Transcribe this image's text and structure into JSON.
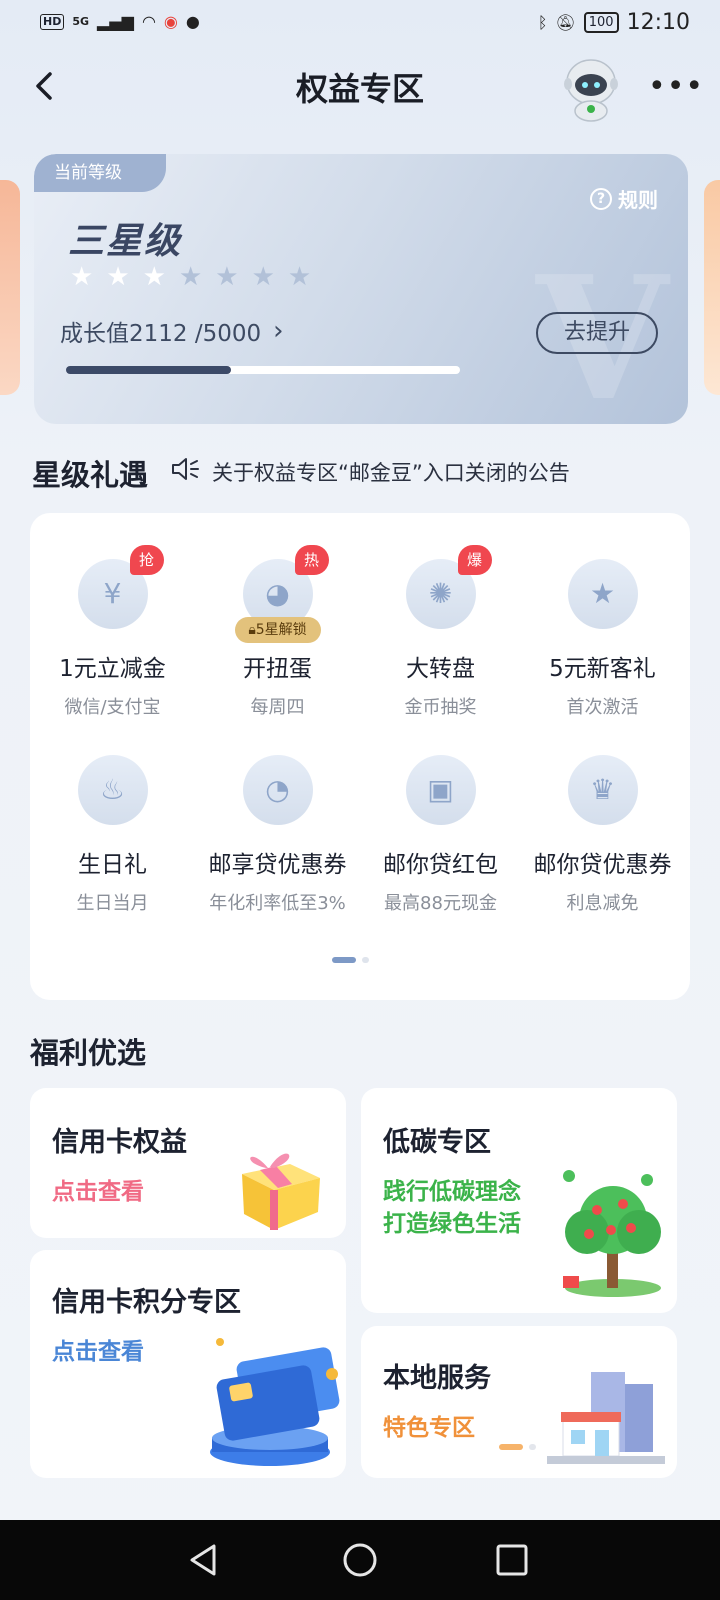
{
  "status_bar": {
    "hd": "HD",
    "signal": "5G",
    "battery": "100",
    "time": "12:10"
  },
  "header": {
    "title": "权益专区"
  },
  "level_card": {
    "tag": "当前等级",
    "level_name": "三星级",
    "stars_total": 7,
    "stars_filled": 3,
    "rule_label": "规则",
    "growth_label": "成长值2112 /5000",
    "growth_progress": 0.42,
    "upgrade_label": "去提升"
  },
  "star_gift": {
    "title": "星级礼遇",
    "notice": "关于权益专区“邮金豆”入口关闭的公告",
    "items": [
      {
        "name": "1元立减金",
        "sub": "微信/支付宝",
        "badge": "抢",
        "icon": "voucher-icon"
      },
      {
        "name": "开扭蛋",
        "sub": "每周四",
        "badge": "热",
        "lock": "5星解锁",
        "icon": "gacha-icon"
      },
      {
        "name": "大转盘",
        "sub": "金币抽奖",
        "badge": "爆",
        "icon": "wheel-icon"
      },
      {
        "name": "5元新客礼",
        "sub": "首次激活",
        "icon": "gift-bag-icon"
      },
      {
        "name": "生日礼",
        "sub": "生日当月",
        "icon": "cake-icon"
      },
      {
        "name": "邮享贷优惠券",
        "sub": "年化利率低至3%",
        "icon": "loan-coupon-icon"
      },
      {
        "name": "邮你贷红包",
        "sub": "最高88元现金",
        "icon": "red-packet-icon"
      },
      {
        "name": "邮你贷优惠券",
        "sub": "利息减免",
        "icon": "crown-icon"
      }
    ]
  },
  "welfare": {
    "title": "福利优选",
    "cards": [
      {
        "title": "信用卡权益",
        "sub": "点击查看",
        "color": "#f06a84"
      },
      {
        "title": "低碳专区",
        "sub1": "践行低碳理念",
        "sub2": "打造绿色生活",
        "color": "#3bb34a"
      },
      {
        "title": "信用卡积分专区",
        "sub": "点击查看",
        "color": "#4a86d6"
      },
      {
        "title": "本地服务",
        "sub": "特色专区",
        "color": "#f0913a"
      }
    ]
  },
  "colors": {
    "accent_red": "#f0474f",
    "progress_fill": "#3c4a68",
    "card_bg": "#ffffff"
  }
}
